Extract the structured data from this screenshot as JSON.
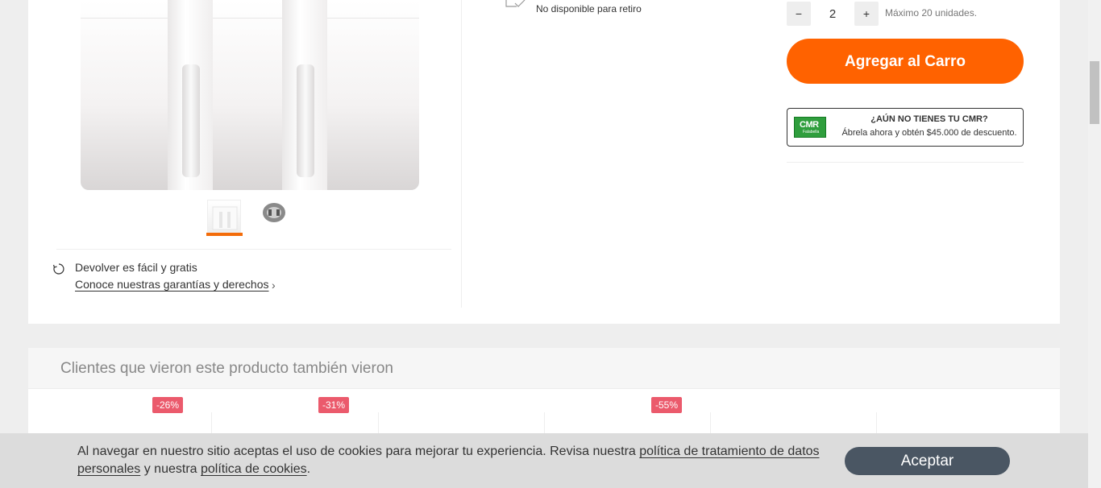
{
  "gallery": {
    "thumbnails": [
      "thumbnail-charger-box",
      "thumbnail-charger-plug"
    ]
  },
  "returns": {
    "title": "Devolver es fácil y gratis",
    "link": "Conoce nuestras garantías y derechos"
  },
  "pickup": {
    "status": "No disponible para retiro"
  },
  "quantity": {
    "minus_label": "−",
    "value": "2",
    "plus_label": "+",
    "max_text": "Máximo 20 unidades."
  },
  "cart": {
    "add_label": "Agregar al Carro"
  },
  "cmr": {
    "logo_text": "CMR",
    "logo_sub": "Falabella",
    "title": "¿AÚN NO TIENES TU CMR?",
    "subtitle": "Ábrela ahora y obtén $45.000 de descuento."
  },
  "recommendations": {
    "title": "Clientes que vieron este producto también vieron",
    "badges": [
      "-26%",
      "-31%",
      "-55%"
    ]
  },
  "cookie": {
    "text_before": "Al navegar en nuestro sitio aceptas el uso de cookies para mejorar tu experiencia. Revisa nuestra ",
    "link_privacy": "política de tratamiento de datos personales",
    "text_middle": " y nuestra ",
    "link_cookies": "política de cookies",
    "text_after": ".",
    "accept_label": "Aceptar"
  },
  "colors": {
    "accent_orange": "#ff6200",
    "discount_badge": "#eb5a6c",
    "cmr_green": "#2f9e3d",
    "accept_button": "#4a5663"
  }
}
